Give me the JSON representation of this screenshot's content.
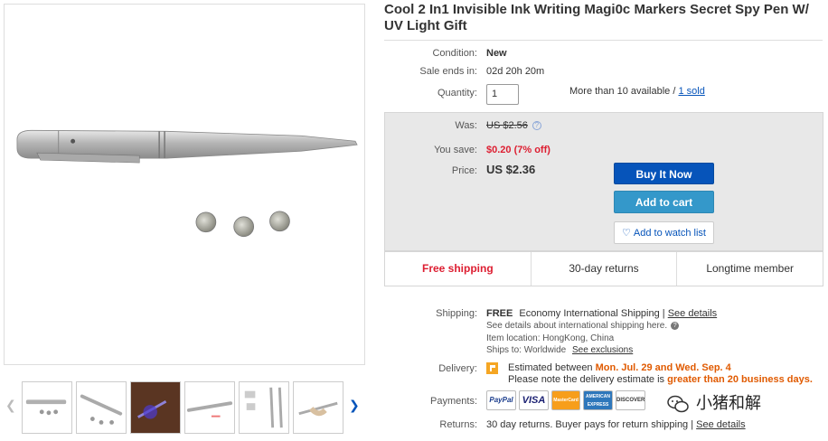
{
  "listing": {
    "title": "Cool 2 In1 Invisible Ink Writing Magi0c Markers Secret Spy Pen W/ UV Light Gift"
  },
  "details": {
    "condition_label": "Condition:",
    "condition_value": "New",
    "sale_ends_label": "Sale ends in:",
    "sale_ends_value": "02d 20h 20m",
    "quantity_label": "Quantity:",
    "quantity_value": "1",
    "availability_text": "More than 10 available /",
    "sold_link": "1 sold"
  },
  "pricing": {
    "was_label": "Was:",
    "was_value": "US $2.56",
    "save_label": "You save:",
    "save_value": "$0.20 (7% off)",
    "price_label": "Price:",
    "price_value": "US $2.36"
  },
  "actions": {
    "buy_now": "Buy It Now",
    "add_to_cart": "Add to cart",
    "watch": "Add to watch list"
  },
  "perks": [
    "Free shipping",
    "30-day returns",
    "Longtime member"
  ],
  "shipping": {
    "label": "Shipping:",
    "free": "FREE",
    "method": "Economy International Shipping |",
    "see_details": "See details",
    "intl_note": "See details about international shipping here.",
    "location": "Item location:  HongKong, China",
    "ships_to": "Ships to:  Worldwide",
    "see_exclusions": "See exclusions"
  },
  "delivery": {
    "label": "Delivery:",
    "estimated_prefix": "Estimated between",
    "date_range": "Mon. Jul. 29 and Wed. Sep. 4",
    "note_prefix": "Please note the delivery estimate is",
    "note_emphasis": "greater than 20 business days."
  },
  "payments": {
    "label": "Payments:",
    "methods": [
      "PayPal",
      "VISA",
      "MasterCard",
      "AMERICAN EXPRESS",
      "DISCOVER"
    ]
  },
  "returns": {
    "label": "Returns:",
    "text": "30 day returns. Buyer pays for return shipping |",
    "see_details": "See details"
  },
  "watermark": {
    "text": "小猪和解"
  },
  "colors": {
    "ebay_blue": "#0654ba",
    "cart_blue": "#3498ca",
    "sale_red": "#dd1e31",
    "delivery_orange": "#e05a00"
  }
}
